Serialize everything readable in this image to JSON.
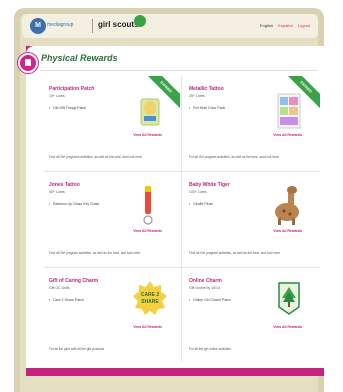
{
  "header": {
    "brand_mark": "M",
    "brand_text": "mediagroup",
    "brand_name": "girl scouts",
    "links": {
      "english": "English",
      "espanol": "Español",
      "logout": "Logout"
    }
  },
  "page_title": "Physical Rewards",
  "rewards": [
    {
      "name": "Participation Patch",
      "price": "10+ Lures",
      "feature": "Girl Gift Things Patch",
      "view": "View All Rewards",
      "desc": "Find all Girl programs activities, as well as the best, and look here.",
      "ribbon": "EARNED"
    },
    {
      "name": "Metallic Tattoo",
      "price": "25+ Lures",
      "feature": "Full Multi Color Pack",
      "view": "View All Rewards",
      "desc": "For all Girl program activities, as well as the best, and look here.",
      "ribbon": "EARNED"
    },
    {
      "name": "Jones Tattoo",
      "price": "50+ Lures",
      "feature": "Rainbow Lip Gloss Key Chain",
      "view": "View All Rewards",
      "desc": "Find all Girl program activities, as well as the best, and look here.",
      "ribbon": ""
    },
    {
      "name": "Baby White Tiger",
      "price": "100+ Lures",
      "feature": "Giraffe Plush",
      "view": "View All Rewards",
      "desc": "Find all Girl program activities, as well as the best, and look here.",
      "ribbon": ""
    },
    {
      "name": "Gift of Caring Charm",
      "price": "Gift OC Units",
      "feature": "Care 2 Share Patch",
      "view": "View All Rewards",
      "desc": "For all the girls with all the gift products.",
      "ribbon": "",
      "badge_line1": "CARE 2",
      "badge_line2": "SHARE"
    },
    {
      "name": "Online Charm",
      "price": "Gift Online by 10/14",
      "feature": "Online Girl Charm Patch",
      "view": "View All Rewards",
      "desc": "For all the girl online activities.",
      "ribbon": ""
    }
  ],
  "colors": {
    "accent_pink": "#c2247f",
    "accent_green": "#2b6f3b",
    "ribbon_green": "#3aa34a"
  }
}
